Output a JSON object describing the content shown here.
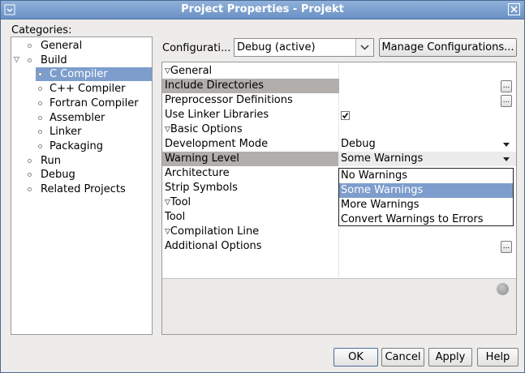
{
  "window": {
    "title": "Project Properties - Projekt"
  },
  "categories": {
    "label": "Categories:",
    "items": [
      {
        "label": "General"
      },
      {
        "label": "Build",
        "expanded": true
      },
      {
        "label": "C Compiler",
        "selected": true
      },
      {
        "label": "C++ Compiler"
      },
      {
        "label": "Fortran Compiler"
      },
      {
        "label": "Assembler"
      },
      {
        "label": "Linker"
      },
      {
        "label": "Packaging"
      },
      {
        "label": "Run"
      },
      {
        "label": "Debug"
      },
      {
        "label": "Related Projects"
      }
    ]
  },
  "configuration": {
    "label": "Configurati...",
    "value": "Debug (active)",
    "manage_label": "Manage Configurations..."
  },
  "properties": {
    "general_header": "General",
    "include_directories": "Include Directories",
    "preprocessor_definitions": "Preprocessor Definitions",
    "use_linker_libraries": "Use Linker Libraries",
    "use_linker_libraries_checked": true,
    "basic_options_header": "Basic Options",
    "development_mode": "Development Mode",
    "development_mode_value": "Debug",
    "warning_level": "Warning Level",
    "warning_level_value": "Some Warnings",
    "architecture": "Architecture",
    "strip_symbols": "Strip Symbols",
    "tool_header": "Tool",
    "tool": "Tool",
    "compilation_line_header": "Compilation Line",
    "additional_options": "Additional Options",
    "ellipsis": "..."
  },
  "warning_dropdown": {
    "options": [
      "No Warnings",
      "Some Warnings",
      "More Warnings",
      "Convert Warnings to Errors"
    ],
    "selected": "Some Warnings"
  },
  "buttons": {
    "ok": "OK",
    "cancel": "Cancel",
    "apply": "Apply",
    "help": "Help"
  },
  "colors": {
    "selection": "#7d9dcc",
    "titlebar": "#7a9ccc",
    "row_highlight": "#b1aeac"
  }
}
